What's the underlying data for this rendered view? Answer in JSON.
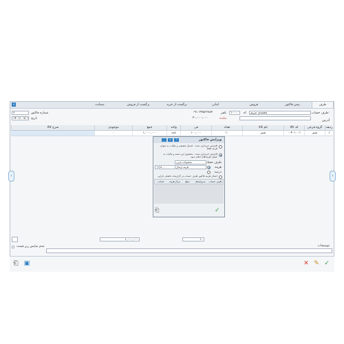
{
  "tabs": [
    "طرف",
    "پیش فاکتور",
    "فروش",
    "امانی",
    "برگشت از خرید",
    "برگشت از فروش",
    "ضمانت"
  ],
  "header": {
    "account_label": "طرف حساب:",
    "account_value": "محمدی مریم",
    "code_label": "کد",
    "code_value": "۱۰۰۰۰",
    "phone_label": "تلفن",
    "phone_value": "۰۹۱۰۳۴۵۶۳۷۸۴",
    "remain_label": "مانده",
    "remain_value": "۲۰,۰۰۰,۰۰۰",
    "address_label": "آدرس",
    "invoice_no_label": "شماره فاکتور",
    "invoice_no_value": "۶",
    "date_label": "تاریخ",
    "date_value": "۱۴۰۱/ ۰۷/ ۱۳"
  },
  "grid": {
    "columns": [
      "ردیف",
      "گروه فرعی",
      "کد کالا",
      "نام کالا",
      "تعداد",
      "فی",
      "واحد",
      "جمع",
      "موجودی",
      "شرح کالا"
    ],
    "rows": [
      [
        "۱",
        "شیر",
        "۰۰۴۰۱۰۰۱",
        "شیر",
        "۱۰",
        "۱۰۰,۰۰۰",
        "عدد",
        "۱,۰۰۰,۰۰۰",
        "۰",
        ""
      ]
    ]
  },
  "dialog": {
    "title": "ویرایش فاکتور",
    "option1": "افزایش خریداری شده - اعمال تخفیفی و مالیات به عنوان هزینه فقط",
    "option2": "افزایش خریداری شده - محصول این دسته و مالیات به عنوان هزینه‌های اعلام شود",
    "account_label": "طرف حساب",
    "account_value": "محصولات غربی",
    "cost_label": "هزینه",
    "cost_value": "هزینه ارسال",
    "amount_label": "مبلغ",
    "amount_value": "۵۰۰۰",
    "discount_label": "درصد",
    "option3": "اعمال هزینه فاکتور طرف حساب در گزارشات فصلی دارایی",
    "table_cols": [
      "طرف حساب",
      "شرح/محل هزینه",
      "مبلغ",
      "مرکز هزینه",
      "حساب"
    ]
  },
  "footer": {
    "total_value": "۱,۰۰۰,۰۰۰",
    "count_value": "۱۰",
    "notes_label": "توضیحات",
    "checkbox_label": "عدم نمایش ریز قیمت"
  }
}
